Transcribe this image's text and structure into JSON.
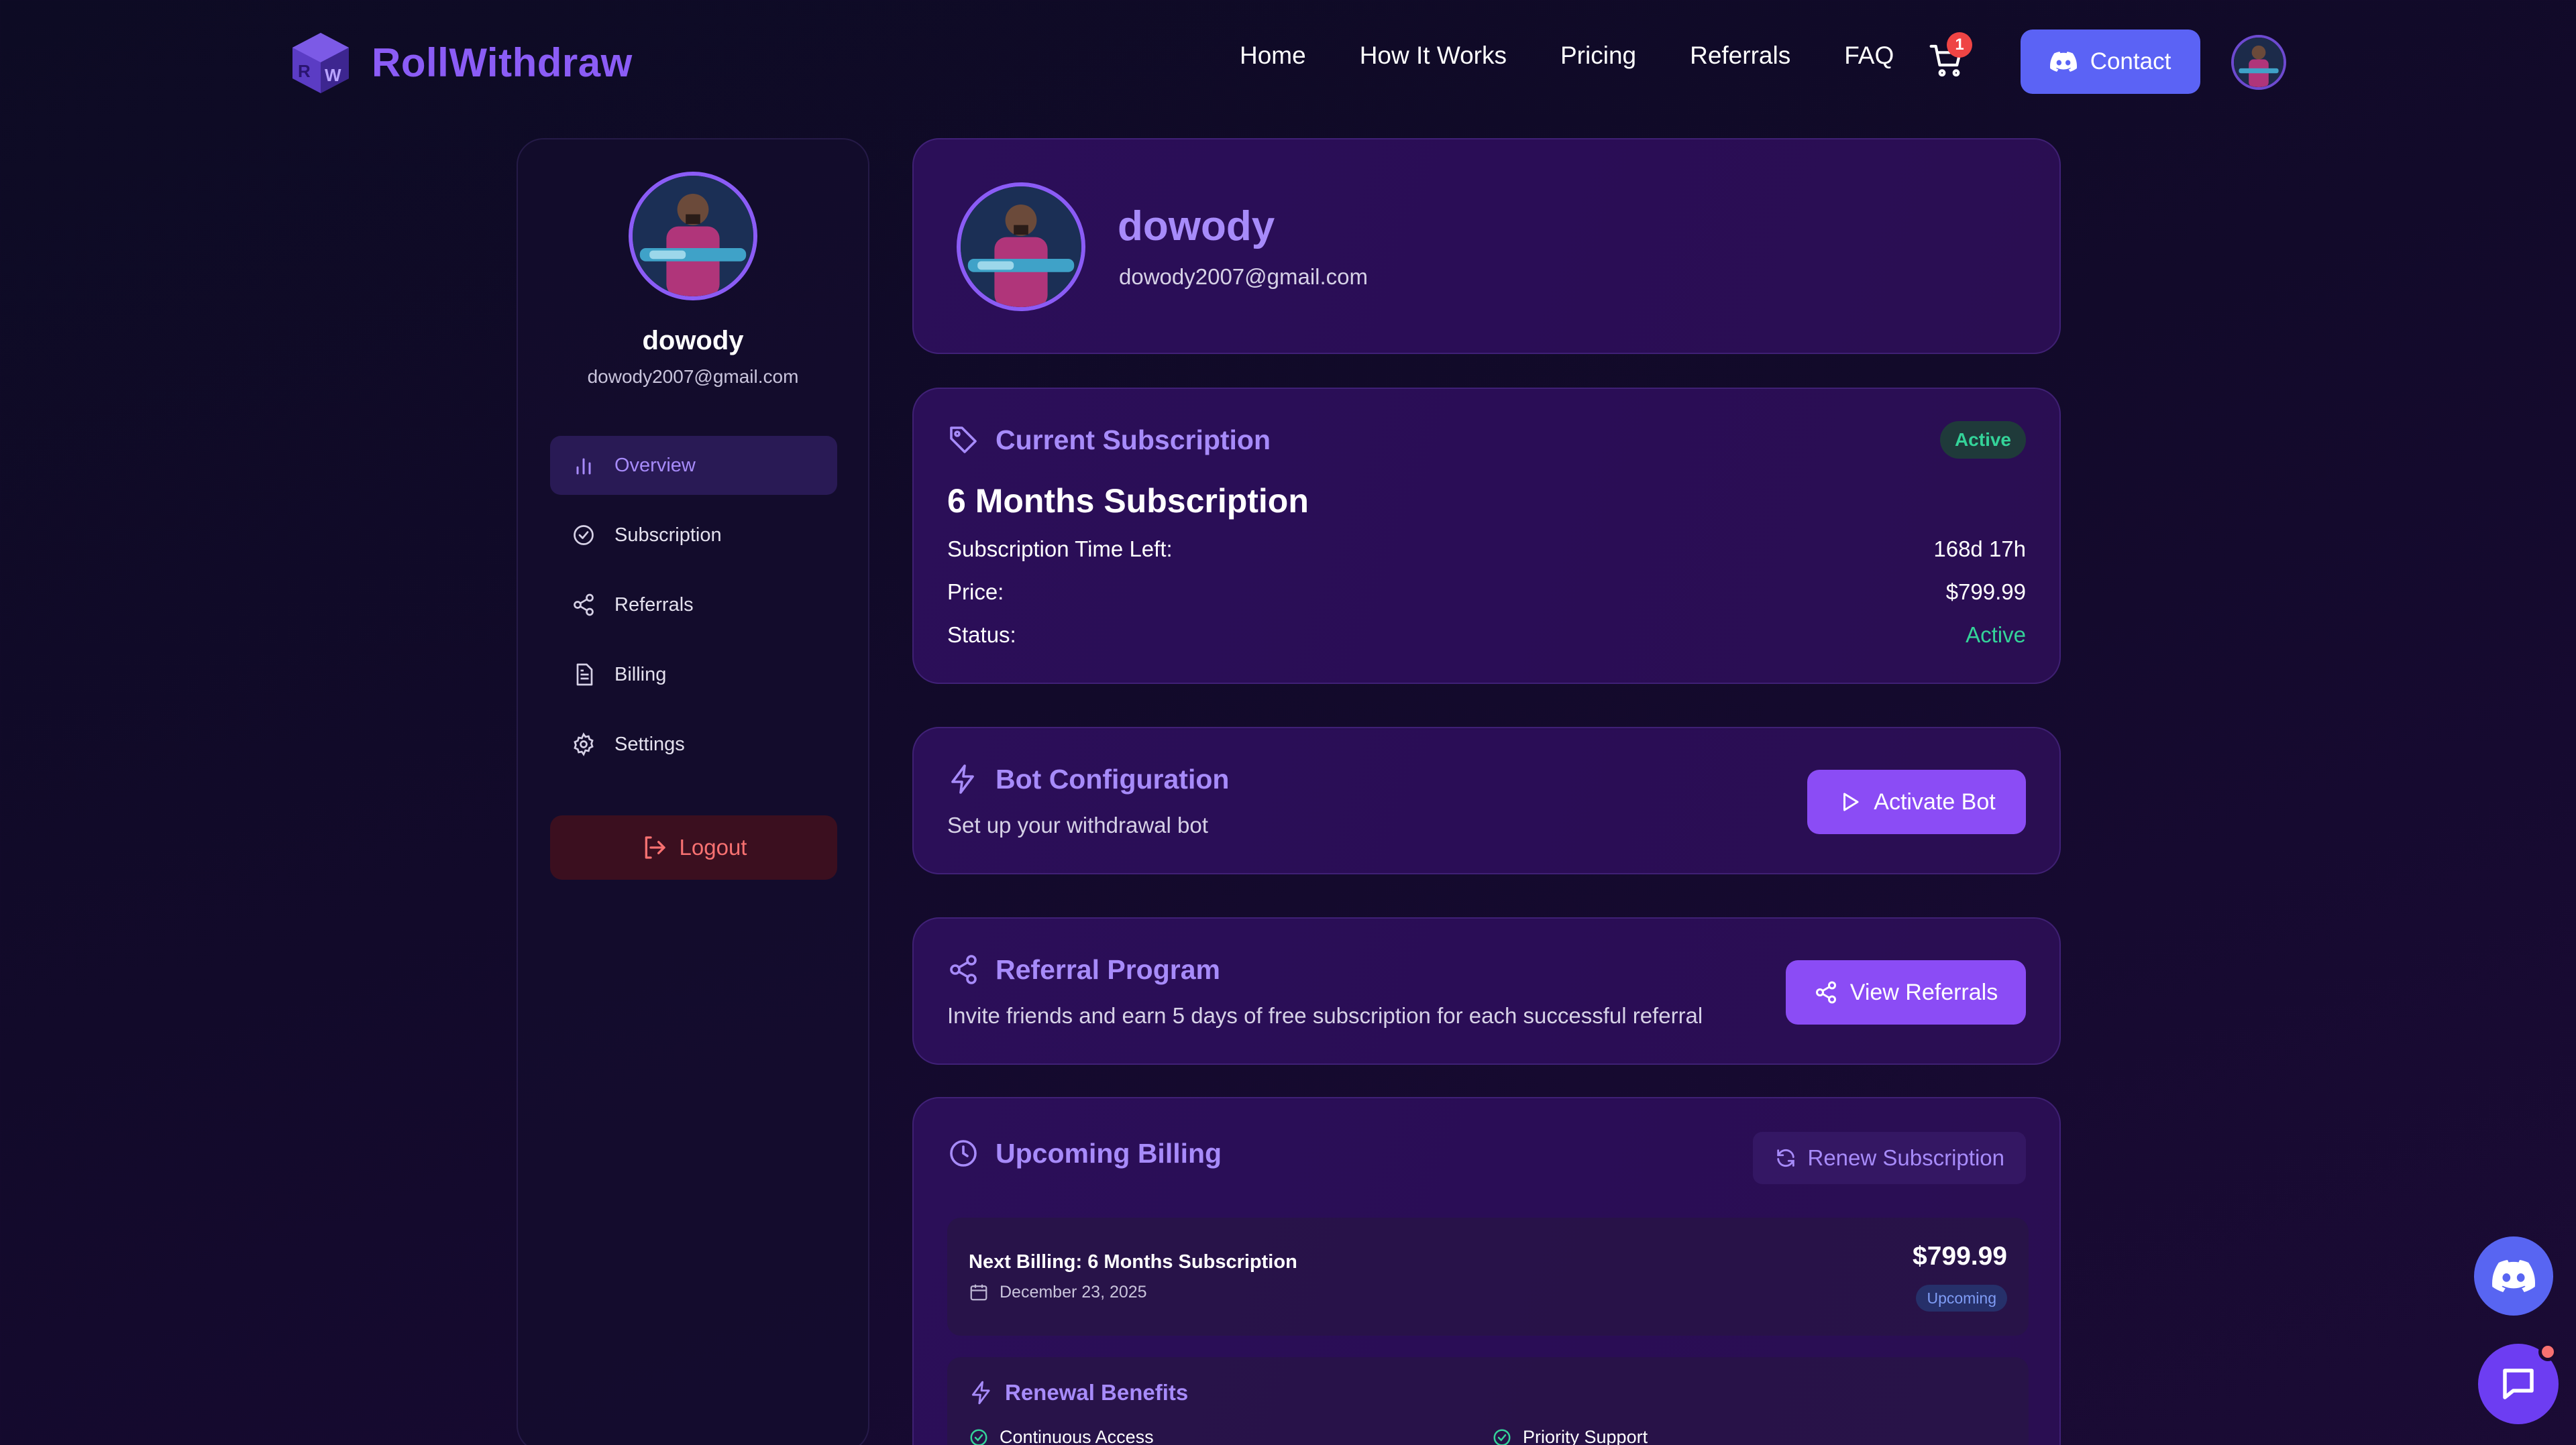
{
  "brand": {
    "name": "RollWithdraw",
    "logo_letters": "RW"
  },
  "nav": {
    "links": [
      "Home",
      "How It Works",
      "Pricing",
      "Referrals",
      "FAQ"
    ],
    "cart_count": "1",
    "contact_label": "Contact",
    "icons": [
      "cart-icon",
      "discord-icon",
      "avatar"
    ]
  },
  "sidebar": {
    "name": "dowody",
    "email": "dowody2007@gmail.com",
    "items": [
      {
        "label": "Overview",
        "icon": "bar-chart-icon",
        "active": true
      },
      {
        "label": "Subscription",
        "icon": "check-circle-icon"
      },
      {
        "label": "Referrals",
        "icon": "share-icon"
      },
      {
        "label": "Billing",
        "icon": "document-icon"
      },
      {
        "label": "Settings",
        "icon": "gear-icon"
      }
    ],
    "logout_label": "Logout"
  },
  "profile": {
    "name": "dowody",
    "email": "dowody2007@gmail.com"
  },
  "subscription": {
    "title": "Current Subscription",
    "badge": "Active",
    "plan": "6 Months Subscription",
    "time_left_label": "Subscription Time Left:",
    "time_left": "168d 17h",
    "price_label": "Price:",
    "price": "$799.99",
    "status_label": "Status:",
    "status": "Active"
  },
  "bot": {
    "title": "Bot Configuration",
    "desc": "Set up your withdrawal bot",
    "button": "Activate Bot"
  },
  "referral": {
    "title": "Referral Program",
    "desc": "Invite friends and earn 5 days of free subscription for each successful referral",
    "button": "View Referrals"
  },
  "billing": {
    "title": "Upcoming Billing",
    "renew_button": "Renew Subscription",
    "next_label": "Next Billing: 6 Months Subscription",
    "date": "December 23, 2025",
    "amount": "$799.99",
    "badge": "Upcoming",
    "benefits_title": "Renewal Benefits",
    "benefits": [
      "Continuous Access",
      "Priority Support"
    ]
  },
  "colors": {
    "accent": "#8b5cf6",
    "active_green": "#34d399",
    "contact_blue": "#5b63f5",
    "logout_red": "#f87171"
  }
}
